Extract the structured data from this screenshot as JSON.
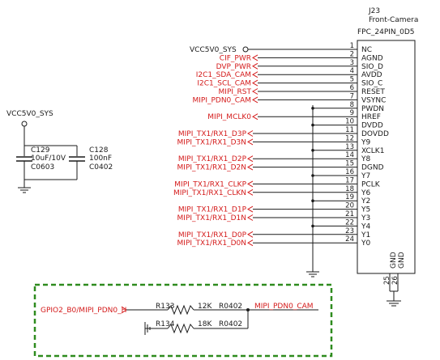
{
  "connector": {
    "ref": "J23",
    "subtitle": "Front-Camera",
    "part": "FPC_24PIN_0D5",
    "gnd_label": "GND",
    "pins": [
      {
        "num": "1",
        "name": "NC",
        "net": "",
        "net_color": "",
        "ground": false
      },
      {
        "num": "2",
        "name": "AGND",
        "net": "CIF_PWR",
        "net_color": "red",
        "ground": false
      },
      {
        "num": "3",
        "name": "SIO_D",
        "net": "DVP_PWR",
        "net_color": "red",
        "ground": false
      },
      {
        "num": "4",
        "name": "AVDD",
        "net": "I2C1_SDA_CAM",
        "net_color": "red",
        "ground": false
      },
      {
        "num": "5",
        "name": "SIO_C",
        "net": "I2C1_SCL_CAM",
        "net_color": "red",
        "ground": false
      },
      {
        "num": "6",
        "name": "RESET",
        "net": "MIPI_RST",
        "net_color": "red",
        "ground": false
      },
      {
        "num": "7",
        "name": "VSYNC",
        "net": "MIPI_PDN0_CAM",
        "net_color": "red",
        "ground": false
      },
      {
        "num": "8",
        "name": "PWDN",
        "net": "",
        "net_color": "",
        "ground": true
      },
      {
        "num": "9",
        "name": "HREF",
        "net": "MIPI_MCLK0",
        "net_color": "red",
        "ground": false
      },
      {
        "num": "10",
        "name": "DVDD",
        "net": "",
        "net_color": "",
        "ground": true
      },
      {
        "num": "11",
        "name": "DOVDD",
        "net": "MIPI_TX1/RX1_D3P",
        "net_color": "red",
        "ground": false
      },
      {
        "num": "12",
        "name": "Y9",
        "net": "MIPI_TX1/RX1_D3N",
        "net_color": "red",
        "ground": false
      },
      {
        "num": "13",
        "name": "XCLK1",
        "net": "",
        "net_color": "",
        "ground": true
      },
      {
        "num": "14",
        "name": "Y8",
        "net": "MIPI_TX1/RX1_D2P",
        "net_color": "red",
        "ground": false
      },
      {
        "num": "15",
        "name": "DGND",
        "net": "MIPI_TX1/RX1_D2N",
        "net_color": "red",
        "ground": false
      },
      {
        "num": "16",
        "name": "Y7",
        "net": "",
        "net_color": "",
        "ground": true
      },
      {
        "num": "17",
        "name": "PCLK",
        "net": "MIPI_TX1/RX1_CLKP",
        "net_color": "red",
        "ground": false
      },
      {
        "num": "18",
        "name": "Y6",
        "net": "MIPI_TX1/RX1_CLKN",
        "net_color": "red",
        "ground": false
      },
      {
        "num": "19",
        "name": "Y2",
        "net": "",
        "net_color": "",
        "ground": true
      },
      {
        "num": "20",
        "name": "Y5",
        "net": "MIPI_TX1/RX1_D1P",
        "net_color": "red",
        "ground": false
      },
      {
        "num": "21",
        "name": "Y3",
        "net": "MIPI_TX1/RX1_D1N",
        "net_color": "red",
        "ground": false
      },
      {
        "num": "22",
        "name": "Y4",
        "net": "",
        "net_color": "",
        "ground": true
      },
      {
        "num": "23",
        "name": "Y1",
        "net": "MIPI_TX1/RX1_D0P",
        "net_color": "red",
        "ground": false
      },
      {
        "num": "24",
        "name": "Y0",
        "net": "MIPI_TX1/RX1_D0N",
        "net_color": "red",
        "ground": false
      }
    ],
    "gnd_pins": [
      "25",
      "26"
    ]
  },
  "power": {
    "vcc_j23": "VCC5V0_SYS",
    "vcc_caps": "VCC5V0_SYS"
  },
  "capacitors": [
    {
      "ref": "C129",
      "value": "10uF/10V",
      "package": "C0603"
    },
    {
      "ref": "C128",
      "value": "100nF",
      "package": "C0402"
    }
  ],
  "resistor_block": {
    "input_net": "GPIO2_B0/MIPI_PDN0_H",
    "output_net": "MIPI_PDN0_CAM",
    "border_color": "#2e8b1e",
    "resistors": [
      {
        "ref": "R133",
        "value": "12K",
        "package": "R0402"
      },
      {
        "ref": "R134",
        "value": "18K",
        "package": "R0402"
      }
    ]
  },
  "colors": {
    "wire": "#1a1a1a",
    "net_label": "#d41a1a",
    "dashed_box": "#2e8b1e"
  }
}
